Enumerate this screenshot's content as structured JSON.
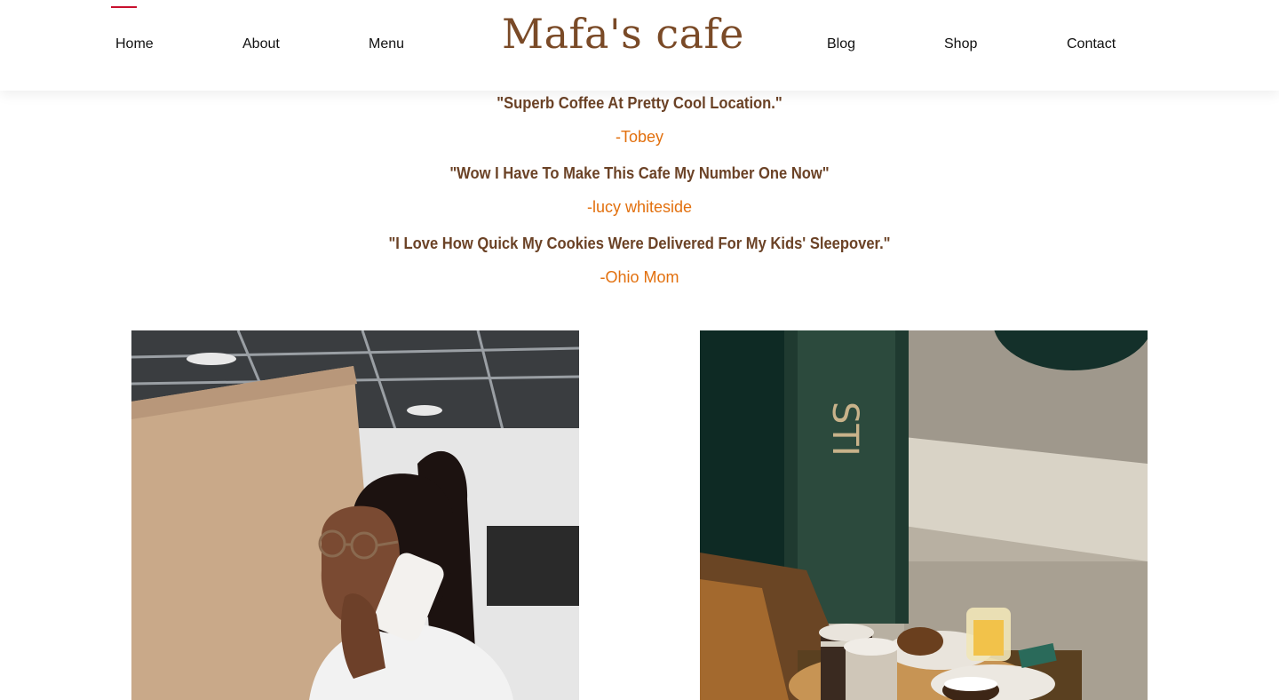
{
  "nav": {
    "left": [
      "Home",
      "About",
      "Menu"
    ],
    "right": [
      "Blog",
      "Shop",
      "Contact"
    ],
    "active": "Home",
    "active_color": "#c8102e"
  },
  "logo": {
    "text": "Mafa's cafe",
    "color": "#7a4a27"
  },
  "testimonials": [
    {
      "quote": "\"Superb Coffee At Pretty Cool Location.\"",
      "author": "-Tobey"
    },
    {
      "quote": "\"Wow I Have To Make This Cafe My Number One Now\"",
      "author": "-lucy whiteside"
    },
    {
      "quote": "\"I Love How Quick My Cookies Were Delivered For My Kids' Sleepover.\"",
      "author": "-Ohio Mom"
    }
  ],
  "colors": {
    "quote": "#6b4226",
    "author": "#e2700e"
  },
  "photos": [
    {
      "name": "woman-on-phone-photo"
    },
    {
      "name": "coffee-and-pastries-photo"
    }
  ]
}
